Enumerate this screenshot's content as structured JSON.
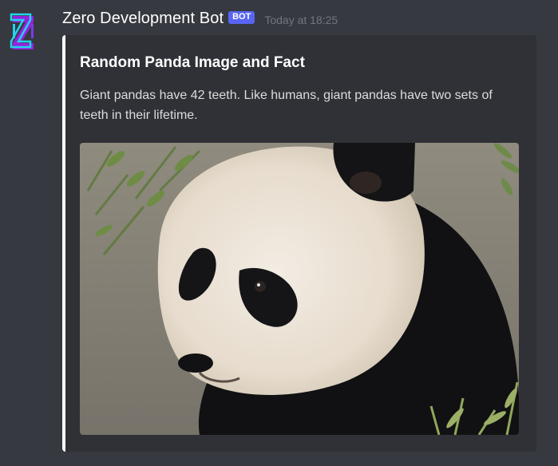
{
  "message": {
    "author": "Zero Development Bot",
    "bot_tag": "BOT",
    "timestamp": "Today at 18:25"
  },
  "embed": {
    "title": "Random Panda Image and Fact",
    "description": "Giant pandas have 42 teeth. Like humans, giant pandas have two sets of teeth in their lifetime.",
    "border_color": "#ffffff",
    "image_subject": "giant panda photo"
  },
  "colors": {
    "background": "#36393f",
    "embed_background": "#2f3136",
    "bot_tag": "#5865f2",
    "timestamp": "#72767d"
  }
}
